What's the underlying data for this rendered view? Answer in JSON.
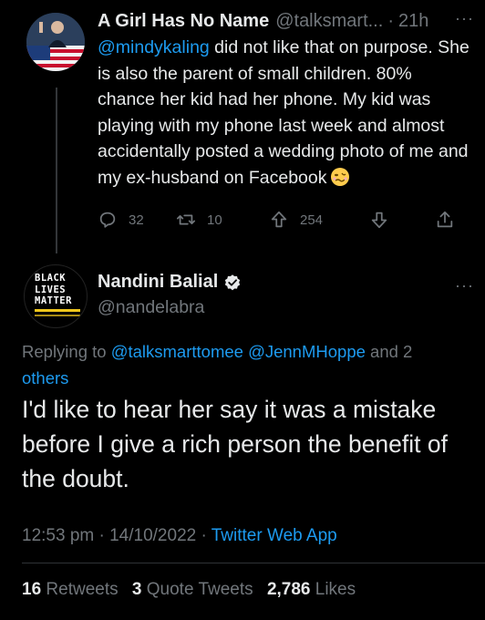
{
  "tweet1": {
    "name": "A Girl Has No Name",
    "handle": "@talksmart...",
    "separator": "·",
    "time": "21h",
    "mention": "@mindykaling",
    "text": " did not like that on purpose. She is also the parent of small children. 80% chance her kid had her phone. My kid was playing with my phone last week and almost accidentally posted a wedding photo of me and my ex-husband on Facebook",
    "emoji": "woozy-face-emoji",
    "actions": {
      "reply_count": "32",
      "retweet_count": "10",
      "like_count": "254"
    }
  },
  "tweet2": {
    "name": "Nandini Balial",
    "handle": "@nandelabra",
    "avatar_text": [
      "BLACK",
      "LIVES",
      "MATTER"
    ],
    "replying_prefix": "Replying to ",
    "replying_users": "@talksmarttomee @JennMHoppe",
    "replying_suffix": " and 2",
    "replying_others": "others",
    "text": "I'd like to hear her say it was a mistake before I give a rich person the benefit of the doubt.",
    "timestamp": "12:53 pm · 14/10/2022 · ",
    "source": "Twitter Web App",
    "stats": {
      "retweets_count": "16",
      "retweets_label": "Retweets",
      "quotes_count": "3",
      "quotes_label": "Quote Tweets",
      "likes_count": "2,786",
      "likes_label": "Likes"
    }
  },
  "colors": {
    "background": "#000000",
    "text": "#e7e9ea",
    "muted": "#71767b",
    "link": "#1d9bf0",
    "verified": "#e7e9ea"
  }
}
